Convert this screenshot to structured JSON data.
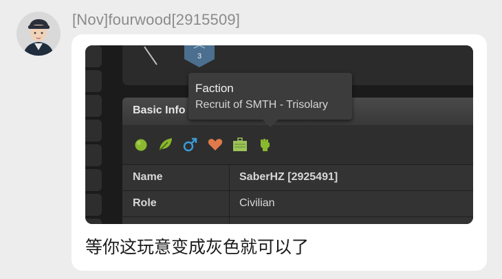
{
  "chat": {
    "sender": "[Nov]fourwood[2915509]",
    "message": "等你这玩意变成灰色就可以了"
  },
  "screenshot": {
    "badge_number": "3",
    "tooltip": {
      "title": "Faction",
      "body": "Recruit of SMTH - Trisolary"
    },
    "panel_title": "Basic Info",
    "status_icons": [
      "green-dot-icon",
      "leaf-icon",
      "male-icon",
      "heart-icon",
      "briefcase-icon",
      "fist-icon"
    ],
    "rows": [
      {
        "label": "Name",
        "value": "SaberHZ [2925491]"
      },
      {
        "label": "Role",
        "value": "Civilian"
      }
    ]
  },
  "colors": {
    "bubble": "#ffffff",
    "background": "#ededed",
    "accent_green": "#8ab82e",
    "male_blue": "#3a9bd6",
    "heart_orange": "#e07a4a",
    "badge_blue": "#4c6f8f"
  }
}
